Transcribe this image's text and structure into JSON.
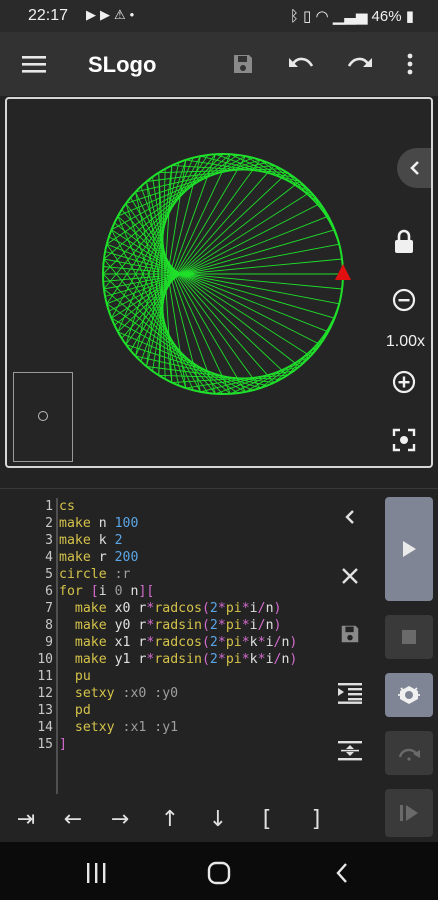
{
  "status_bar": {
    "time": "22:17",
    "left_icons": [
      "youtube-icon",
      "youtube-icon",
      "warning-icon",
      "dot-icon"
    ],
    "battery": "46%",
    "right_icons": [
      "bluetooth-icon",
      "vibrate-icon",
      "wifi-icon",
      "signal-icon",
      "battery-icon"
    ]
  },
  "app_bar": {
    "title": "SLogo",
    "actions": [
      "menu-icon",
      "save-icon",
      "undo-icon",
      "redo-icon",
      "more-icon"
    ]
  },
  "canvas": {
    "zoom": "1.00x",
    "controls": [
      "chevron-left-icon",
      "lock-icon",
      "zoom-out-icon",
      "zoom-in-icon",
      "center-icon"
    ],
    "drawing_color": "#1fe02a",
    "turtle_color": "#e01010",
    "turtle_heading": "north",
    "params": {
      "n": 100,
      "k": 2,
      "r": 200
    }
  },
  "editor": {
    "line_numbers": [
      "1",
      "2",
      "3",
      "4",
      "5",
      "6",
      "7",
      "8",
      "9",
      "10",
      "11",
      "12",
      "13",
      "14",
      "15"
    ],
    "lines": [
      [
        {
          "t": "cs",
          "c": "kw"
        }
      ],
      [
        {
          "t": "make",
          "c": "kw"
        },
        {
          "t": " n ",
          "c": "plain"
        },
        {
          "t": "100",
          "c": "num"
        }
      ],
      [
        {
          "t": "make",
          "c": "kw"
        },
        {
          "t": " k ",
          "c": "plain"
        },
        {
          "t": "2",
          "c": "num"
        }
      ],
      [
        {
          "t": "make",
          "c": "kw"
        },
        {
          "t": " r ",
          "c": "plain"
        },
        {
          "t": "200",
          "c": "num"
        }
      ],
      [
        {
          "t": "circle",
          "c": "kw"
        },
        {
          "t": " :r",
          "c": "var"
        }
      ],
      [
        {
          "t": "for",
          "c": "kw"
        },
        {
          "t": " [",
          "c": "op"
        },
        {
          "t": "i",
          "c": "plain"
        },
        {
          "t": " 0 ",
          "c": "var"
        },
        {
          "t": "n",
          "c": "plain"
        },
        {
          "t": "][",
          "c": "op"
        }
      ],
      [
        {
          "t": "  make",
          "c": "kw"
        },
        {
          "t": " x0 ",
          "c": "plain"
        },
        {
          "t": "r",
          "c": "plain"
        },
        {
          "t": "*",
          "c": "op"
        },
        {
          "t": "radcos",
          "c": "fn"
        },
        {
          "t": "(",
          "c": "op"
        },
        {
          "t": "2",
          "c": "num"
        },
        {
          "t": "*",
          "c": "op"
        },
        {
          "t": "pi",
          "c": "kw"
        },
        {
          "t": "*",
          "c": "op"
        },
        {
          "t": "i",
          "c": "plain"
        },
        {
          "t": "/",
          "c": "op"
        },
        {
          "t": "n",
          "c": "plain"
        },
        {
          "t": ")",
          "c": "op"
        }
      ],
      [
        {
          "t": "  make",
          "c": "kw"
        },
        {
          "t": " y0 ",
          "c": "plain"
        },
        {
          "t": "r",
          "c": "plain"
        },
        {
          "t": "*",
          "c": "op"
        },
        {
          "t": "radsin",
          "c": "fn"
        },
        {
          "t": "(",
          "c": "op"
        },
        {
          "t": "2",
          "c": "num"
        },
        {
          "t": "*",
          "c": "op"
        },
        {
          "t": "pi",
          "c": "kw"
        },
        {
          "t": "*",
          "c": "op"
        },
        {
          "t": "i",
          "c": "plain"
        },
        {
          "t": "/",
          "c": "op"
        },
        {
          "t": "n",
          "c": "plain"
        },
        {
          "t": ")",
          "c": "op"
        }
      ],
      [
        {
          "t": "  make",
          "c": "kw"
        },
        {
          "t": " x1 ",
          "c": "plain"
        },
        {
          "t": "r",
          "c": "plain"
        },
        {
          "t": "*",
          "c": "op"
        },
        {
          "t": "radcos",
          "c": "fn"
        },
        {
          "t": "(",
          "c": "op"
        },
        {
          "t": "2",
          "c": "num"
        },
        {
          "t": "*",
          "c": "op"
        },
        {
          "t": "pi",
          "c": "kw"
        },
        {
          "t": "*",
          "c": "op"
        },
        {
          "t": "k",
          "c": "plain"
        },
        {
          "t": "*",
          "c": "op"
        },
        {
          "t": "i",
          "c": "plain"
        },
        {
          "t": "/",
          "c": "op"
        },
        {
          "t": "n",
          "c": "plain"
        },
        {
          "t": ")",
          "c": "op"
        }
      ],
      [
        {
          "t": "  make",
          "c": "kw"
        },
        {
          "t": " y1 ",
          "c": "plain"
        },
        {
          "t": "r",
          "c": "plain"
        },
        {
          "t": "*",
          "c": "op"
        },
        {
          "t": "radsin",
          "c": "fn"
        },
        {
          "t": "(",
          "c": "op"
        },
        {
          "t": "2",
          "c": "num"
        },
        {
          "t": "*",
          "c": "op"
        },
        {
          "t": "pi",
          "c": "kw"
        },
        {
          "t": "*",
          "c": "op"
        },
        {
          "t": "k",
          "c": "plain"
        },
        {
          "t": "*",
          "c": "op"
        },
        {
          "t": "i",
          "c": "plain"
        },
        {
          "t": "/",
          "c": "op"
        },
        {
          "t": "n",
          "c": "plain"
        },
        {
          "t": ")",
          "c": "op"
        }
      ],
      [
        {
          "t": "  pu",
          "c": "kw"
        }
      ],
      [
        {
          "t": "  setxy",
          "c": "kw"
        },
        {
          "t": " :x0 :y0",
          "c": "var"
        }
      ],
      [
        {
          "t": "  pd",
          "c": "kw"
        }
      ],
      [
        {
          "t": "  setxy",
          "c": "kw"
        },
        {
          "t": " :x1 :y1",
          "c": "var"
        }
      ],
      [
        {
          "t": "]",
          "c": "op"
        }
      ]
    ]
  },
  "editor_tools": [
    "chevron-left-icon",
    "close-icon",
    "save-icon",
    "indent-icon",
    "format-icon"
  ],
  "run_controls": [
    "play-icon",
    "stop-icon",
    "debug-icon",
    "step-over-icon",
    "step-icon"
  ],
  "keys": [
    "⇥",
    "←",
    "→",
    "↑",
    "↓",
    "[",
    "]"
  ],
  "nav_bar": [
    "recents-icon",
    "home-icon",
    "back-icon"
  ]
}
